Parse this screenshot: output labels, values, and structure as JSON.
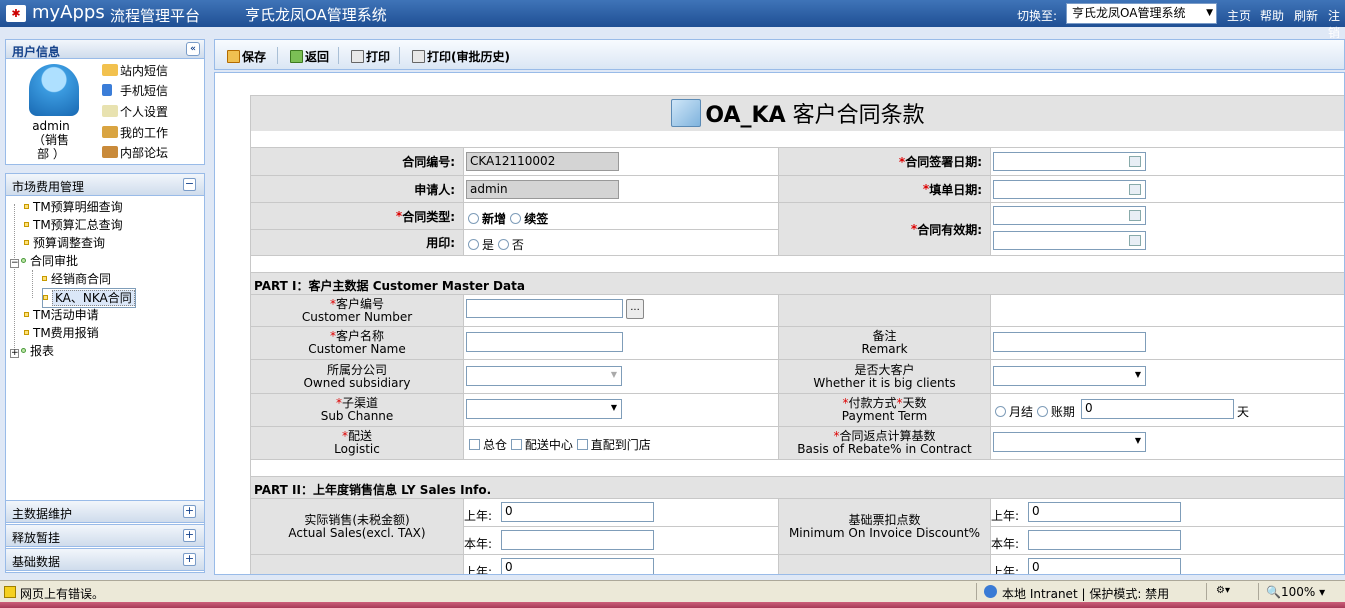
{
  "topbar": {
    "logo": "myApps",
    "platform": "流程管理平台",
    "system_title": "亨氏龙凤OA管理系统",
    "switch_label": "切换至:",
    "switch_value": "亨氏龙凤OA管理系统",
    "links": [
      "主页",
      "帮助",
      "刷新",
      "注销"
    ]
  },
  "user_panel": {
    "title": "用户信息",
    "name": "admin",
    "dept_line1": "（销售",
    "dept_line2": "部  ）",
    "links": [
      "站内短信",
      "手机短信",
      "个人设置",
      "我的工作",
      "内部论坛"
    ]
  },
  "nav": {
    "title": "市场费用管理",
    "items": [
      "TM预算明细查询",
      "TM预算汇总查询",
      "预算调整查询",
      "合同审批",
      "经销商合同",
      "KA、NKA合同",
      "TM活动申请",
      "TM费用报销",
      "报表"
    ],
    "bottom_panels": [
      "主数据维护",
      "释放暂挂",
      "基础数据"
    ]
  },
  "toolbar": {
    "save": "保存",
    "back": "返回",
    "print": "打印",
    "print_history": "打印(审批历史)"
  },
  "form": {
    "title_bold": "OA_KA",
    "title_rest": " 客户合同条款",
    "contract_no_label": "合同编号:",
    "contract_no": "CKA12110002",
    "applicant_label": "申请人:",
    "applicant": "admin",
    "contract_type_label": "合同类型:",
    "type_new": "新增",
    "type_renew": "续签",
    "seal_label": "用印:",
    "seal_yes": "是",
    "seal_no": "否",
    "sign_date_label": "合同签署日期:",
    "fill_date_label": "填单日期:",
    "valid_period_label": "合同有效期:",
    "part1": "PART I：客户主数据  Customer Master Data",
    "customer_no_cn": "客户编号",
    "customer_no_en": "Customer Number",
    "browse_btn": "...",
    "customer_name_cn": "客户名称",
    "customer_name_en": "Customer Name",
    "remark_cn": "备注",
    "remark_en": "Remark",
    "subsidiary_cn": "所属分公司",
    "subsidiary_en": "Owned subsidiary",
    "big_client_cn": "是否大客户",
    "big_client_en": "Whether it is big clients",
    "sub_channel_cn": "子渠道",
    "sub_channel_en": "Sub Channe",
    "payment_cn_a": "付款方式",
    "payment_cn_b": "天数",
    "payment_en": "Payment Term",
    "pay_monthly": "月结",
    "pay_period": "账期",
    "pay_days": "0",
    "pay_unit": "天",
    "logistic_cn": "配送",
    "logistic_en": "Logistic",
    "log_warehouse": "总仓",
    "log_dc": "配送中心",
    "log_direct": "直配到门店",
    "rebate_cn": "合同返点计算基数",
    "rebate_en": "Basis of Rebate% in Contract",
    "part2": "PART II：上年度销售信息  LY Sales Info.",
    "actual_sales_cn": "实际销售(未税金额)",
    "actual_sales_en": "Actual Sales(excl. TAX)",
    "last_year": "上年:",
    "this_year": "本年:",
    "sales_last": "0",
    "sales_this": "",
    "min_discount_cn": "基础票扣点数",
    "min_discount_en": "Minimum On Invoice Discount%",
    "disc_last": "0",
    "disc_this": "",
    "row_last_a": "0",
    "row_last_b": "0"
  },
  "statusbar": {
    "message": "网页上有错误。",
    "zone": "本地 Intranet | 保护模式: 禁用",
    "zoom": "100%"
  }
}
